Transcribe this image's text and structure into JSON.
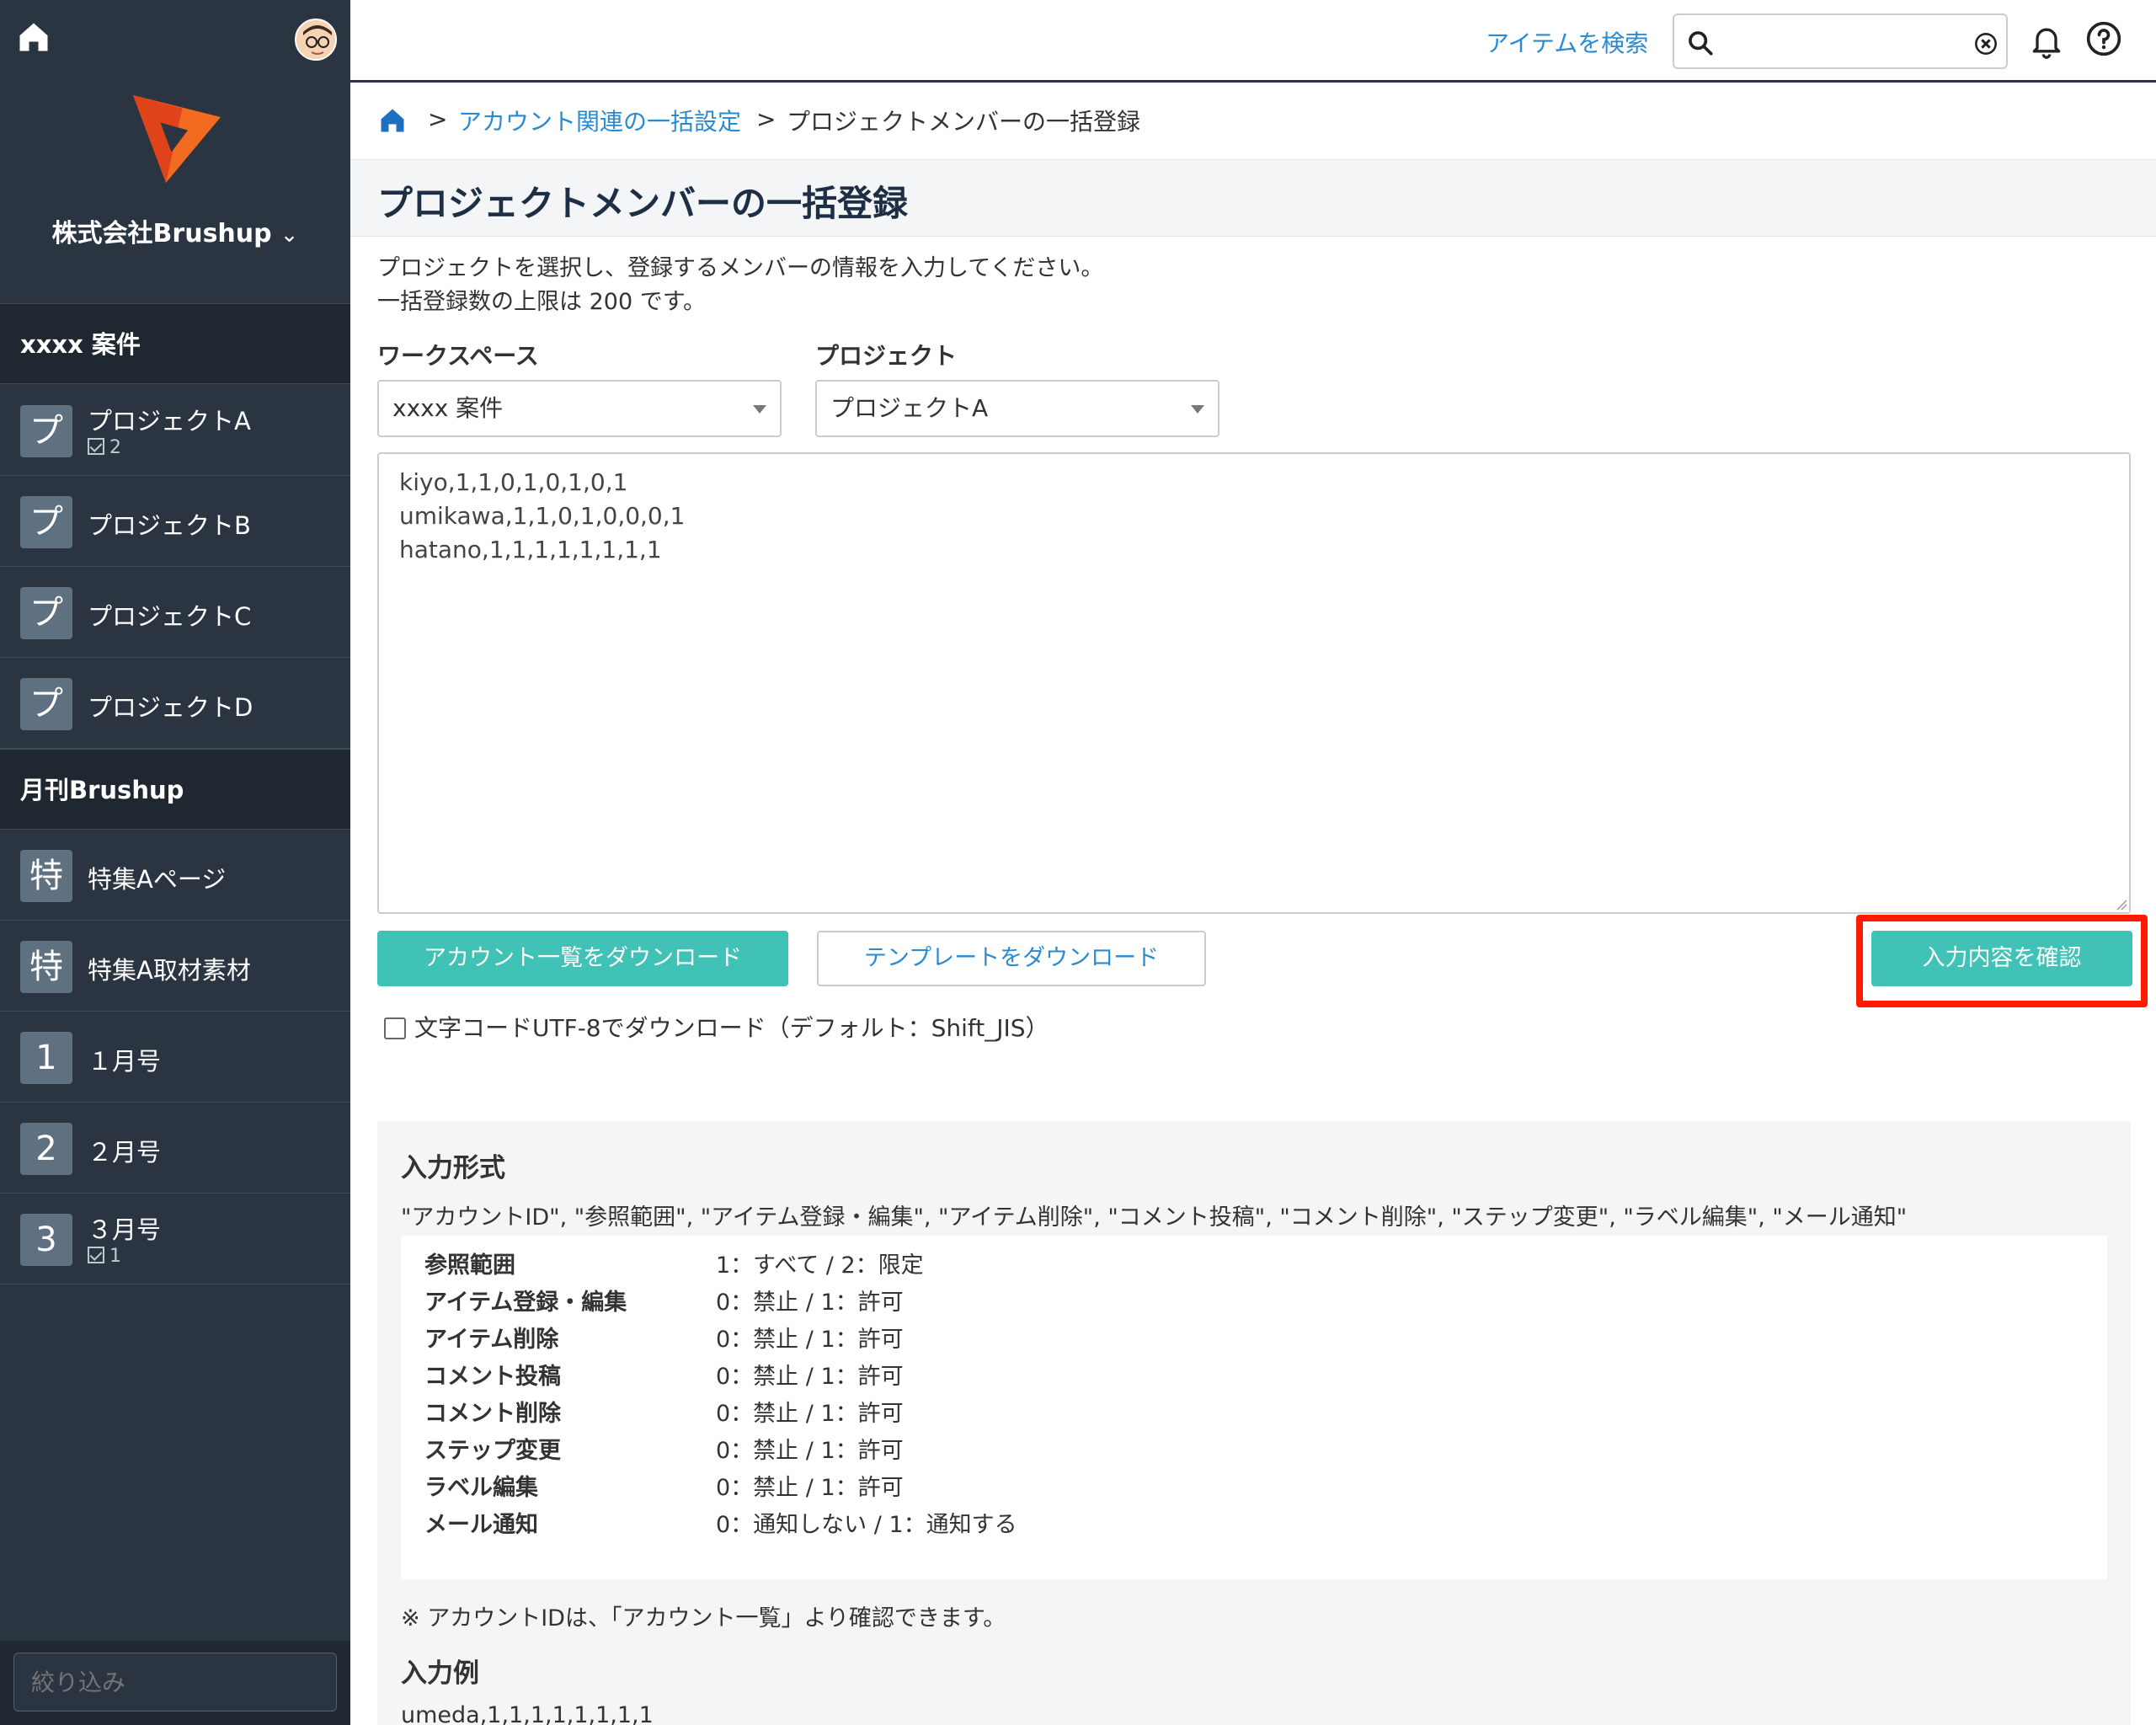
{
  "sidebar": {
    "company": "株式会社Brushup",
    "groups": [
      {
        "name": "xxxx 案件"
      },
      {
        "name": "月刊Brushup"
      }
    ],
    "items": [
      {
        "badge": "プ",
        "label": "プロジェクトA",
        "count": "2"
      },
      {
        "badge": "プ",
        "label": "プロジェクトB"
      },
      {
        "badge": "プ",
        "label": "プロジェクトC"
      },
      {
        "badge": "プ",
        "label": "プロジェクトD"
      },
      {
        "badge": "特",
        "label": "特集Aページ"
      },
      {
        "badge": "特",
        "label": "特集A取材素材"
      },
      {
        "badge": "1",
        "label": "１月号"
      },
      {
        "badge": "2",
        "label": "２月号"
      },
      {
        "badge": "3",
        "label": "３月号",
        "count": "1"
      }
    ],
    "filter_placeholder": "絞り込み"
  },
  "topbar": {
    "search_link": "アイテムを検索"
  },
  "breadcrumb": {
    "sep": ">",
    "parent": "アカウント関連の一括設定",
    "current": "プロジェクトメンバーの一括登録"
  },
  "page": {
    "title": "プロジェクトメンバーの一括登録",
    "desc_line1": "プロジェクトを選択し、登録するメンバーの情報を入力してください。",
    "desc_line2": "一括登録数の上限は 200 です。"
  },
  "form": {
    "workspace_label": "ワークスペース",
    "workspace_value": "xxxx 案件",
    "project_label": "プロジェクト",
    "project_value": "プロジェクトA",
    "textarea_lines": [
      "kiyo,1,1,0,1,0,1,0,1",
      "umikawa,1,1,0,1,0,0,0,1",
      "hatano,1,1,1,1,1,1,1,1"
    ],
    "btn_download_accounts": "アカウント一覧をダウンロード",
    "btn_download_template": "テンプレートをダウンロード",
    "btn_confirm": "入力内容を確認",
    "checkbox_label": "文字コードUTF-8でダウンロード（デフォルト：Shift_JIS）"
  },
  "format": {
    "title": "入力形式",
    "columns": "\"アカウントID\", \"参照範囲\", \"アイテム登録・編集\", \"アイテム削除\", \"コメント投稿\", \"コメント削除\", \"ステップ変更\", \"ラベル編集\", \"メール通知\"",
    "rows": [
      {
        "key": "参照範囲",
        "value": "1：すべて / 2：限定"
      },
      {
        "key": "アイテム登録・編集",
        "value": "0：禁止 / 1：許可"
      },
      {
        "key": "アイテム削除",
        "value": "0：禁止 / 1：許可"
      },
      {
        "key": "コメント投稿",
        "value": "0：禁止 / 1：許可"
      },
      {
        "key": "コメント削除",
        "value": "0：禁止 / 1：許可"
      },
      {
        "key": "ステップ変更",
        "value": "0：禁止 / 1：許可"
      },
      {
        "key": "ラベル編集",
        "value": "0：禁止 / 1：許可"
      },
      {
        "key": "メール通知",
        "value": "0：通知しない / 1：通知する"
      }
    ],
    "note": "※ アカウントIDは、「アカウント一覧」より確認できます。",
    "example_title": "入力例",
    "example_line": "umeda,1,1,1,1,1,1,1,1"
  },
  "colors": {
    "sidebar_bg": "#2b3541",
    "accent": "#40c2b6",
    "link": "#2a8bd0",
    "highlight": "#ff1a00"
  }
}
